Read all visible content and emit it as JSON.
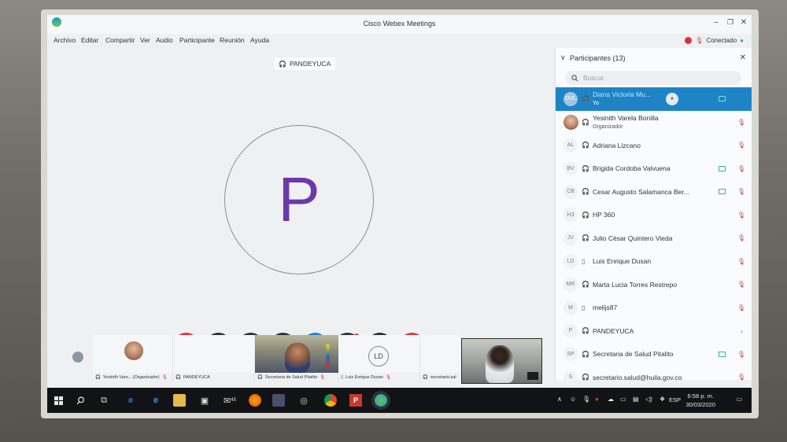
{
  "window": {
    "title": "Cisco Webex Meetings",
    "minimize": "–",
    "restore": "❐",
    "close": "✕"
  },
  "menu": [
    "Archivo",
    "Editar",
    "Compartir",
    "Ver",
    "Audio",
    "Participante",
    "Reunión",
    "Ayuda"
  ],
  "status": {
    "connection": "Conectado"
  },
  "stage": {
    "active_speaker": "PANDEYUCA",
    "avatar_letter": "P"
  },
  "controls": [
    {
      "name": "mute-button",
      "color": "#e0353c",
      "icon": "mic-off-icon"
    },
    {
      "name": "stop-video-button",
      "color": "#2b2f36",
      "icon": "video-off-icon"
    },
    {
      "name": "share-button",
      "color": "#2b2f36",
      "icon": "share-icon"
    },
    {
      "name": "record-button",
      "color": "#2b2f36",
      "icon": "record-icon"
    },
    {
      "name": "participants-button",
      "color": "#1f84c6",
      "icon": "person-icon"
    },
    {
      "name": "chat-button",
      "color": "#2b2f36",
      "icon": "chat-icon"
    },
    {
      "name": "more-button",
      "color": "#2b2f36",
      "icon": "more-icon"
    },
    {
      "name": "leave-button",
      "color": "#e0353c",
      "icon": "x-icon"
    }
  ],
  "filmstrip": {
    "tile1_label": "Yesinith Vare... (Organizador)",
    "tile2_label": "PANDEYUCA",
    "tile3_label": "Secretaria de Salud Pitalito",
    "tile4_initials": "LD",
    "tile4_label": "Luis Enrique Dusan",
    "tile5_label": "secretario.sal"
  },
  "sidebar": {
    "title": "Participantes (13)",
    "search_placeholder": "Buscar",
    "participants": [
      {
        "initials": "DVL",
        "name": "Diana Victoria Mu...",
        "sub": "Yo",
        "video": true,
        "mic": false,
        "selected": true
      },
      {
        "initials": "",
        "name": "Yesinith Varela Bonilla",
        "sub": "Organizador",
        "video": false,
        "mic": true,
        "photo": true
      },
      {
        "initials": "AL",
        "name": "Adriana Lizcano",
        "sub": "",
        "video": false,
        "mic": true
      },
      {
        "initials": "BV",
        "name": "Brigida Cordoba Valvuena",
        "sub": "",
        "video": true,
        "mic": true
      },
      {
        "initials": "CB",
        "name": "Cesar Augusto Salamanca Ber...",
        "sub": "",
        "video": true,
        "mic": true
      },
      {
        "initials": "H3",
        "name": "HP 360",
        "sub": "",
        "video": false,
        "mic": true
      },
      {
        "initials": "JV",
        "name": "Julio César Quintero Vieda",
        "sub": "",
        "video": false,
        "mic": true
      },
      {
        "initials": "LD",
        "name": "Luis Enrique Dusan",
        "sub": "",
        "video": false,
        "mic": true,
        "phone": true
      },
      {
        "initials": "MR",
        "name": "Marta Lucia Torres Restrepo",
        "sub": "",
        "video": false,
        "mic": true
      },
      {
        "initials": "M",
        "name": "melijs87",
        "sub": "",
        "video": false,
        "mic": true,
        "phone": true
      },
      {
        "initials": "P",
        "name": "PANDEYUCA",
        "sub": "",
        "video": false,
        "mic": false,
        "arrow": true
      },
      {
        "initials": "SP",
        "name": "Secretaria de Salud Pitalito",
        "sub": "",
        "video": true,
        "mic": true
      },
      {
        "initials": "S",
        "name": "secretario.salud@huila.gov.co",
        "sub": "",
        "video": false,
        "mic": true
      }
    ]
  },
  "taskbar": {
    "lang": "ESP",
    "time": "6:58 p. m.",
    "date": "30/03/2020",
    "mail_badge": "45"
  }
}
